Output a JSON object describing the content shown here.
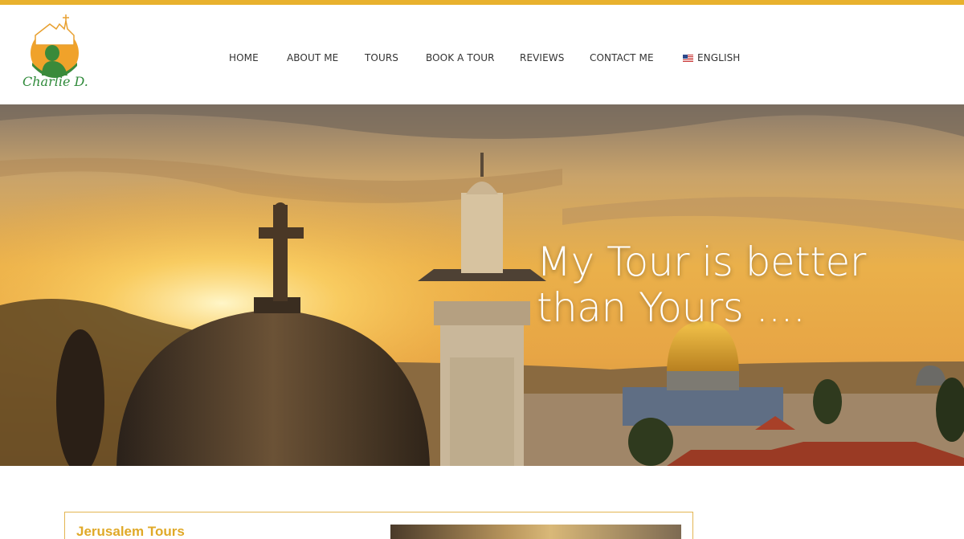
{
  "logo": {
    "text": "Charlie D."
  },
  "nav": {
    "items": [
      {
        "label": "HOME"
      },
      {
        "label": "ABOUT ME"
      },
      {
        "label": "TOURS"
      },
      {
        "label": "BOOK A TOUR"
      },
      {
        "label": "REVIEWS"
      },
      {
        "label": "CONTACT ME"
      }
    ],
    "language": {
      "label": "ENGLISH",
      "flag": "us-flag-icon"
    }
  },
  "hero": {
    "heading_line1": "My Tour is better",
    "heading_line2": "than Yours ...."
  },
  "section": {
    "title": "Jerusalem Tours"
  },
  "colors": {
    "accent": "#e8b12e",
    "card_title": "#e0a928",
    "nav_text": "#333333"
  }
}
